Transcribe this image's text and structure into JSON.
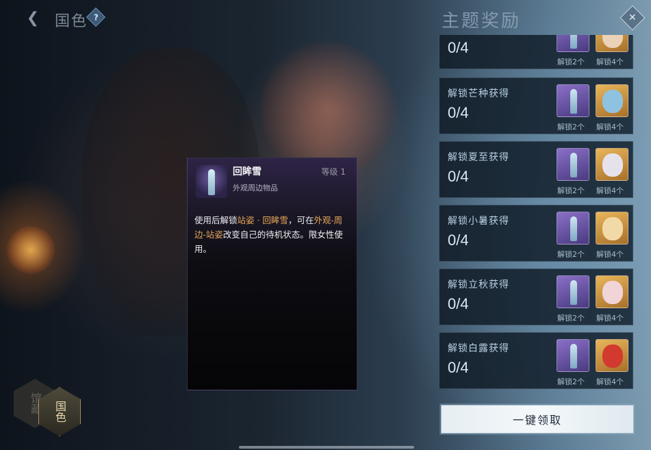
{
  "header": {
    "back_icon": "back-arrow-icon",
    "title": "国色",
    "help_icon": "question-icon",
    "panel_title": "主题奖励",
    "close_icon": "close-diamond-icon"
  },
  "rewards": [
    {
      "title": "",
      "progress": "0/4",
      "label_a": "解锁2个",
      "label_b": "解锁4个",
      "face_color": "#e9d2b6"
    },
    {
      "title": "解锁芒种获得",
      "progress": "0/4",
      "label_a": "解锁2个",
      "label_b": "解锁4个",
      "face_color": "#8fc2e0"
    },
    {
      "title": "解锁夏至获得",
      "progress": "0/4",
      "label_a": "解锁2个",
      "label_b": "解锁4个",
      "face_color": "#e6e2ec"
    },
    {
      "title": "解锁小暑获得",
      "progress": "0/4",
      "label_a": "解锁2个",
      "label_b": "解锁4个",
      "face_color": "#f2d9a8"
    },
    {
      "title": "解锁立秋获得",
      "progress": "0/4",
      "label_a": "解锁2个",
      "label_b": "解锁4个",
      "face_color": "#f1d4d6"
    },
    {
      "title": "解锁白露获得",
      "progress": "0/4",
      "label_a": "解锁2个",
      "label_b": "解锁4个",
      "face_color": "#d23a30"
    }
  ],
  "claim_button": "一键领取",
  "tabs": {
    "inactive": "馆藏",
    "active": "国色"
  },
  "tooltip": {
    "name": "回眸雪",
    "level": "等级 1",
    "category": "外观周边物品",
    "desc_1": "使用后解锁",
    "desc_hl_1": "站姿 · 回眸雪",
    "desc_2": "，可在",
    "desc_hl_2": "外观-周边-站姿",
    "desc_3": "改变自己的待机状态。限女性使用。"
  }
}
